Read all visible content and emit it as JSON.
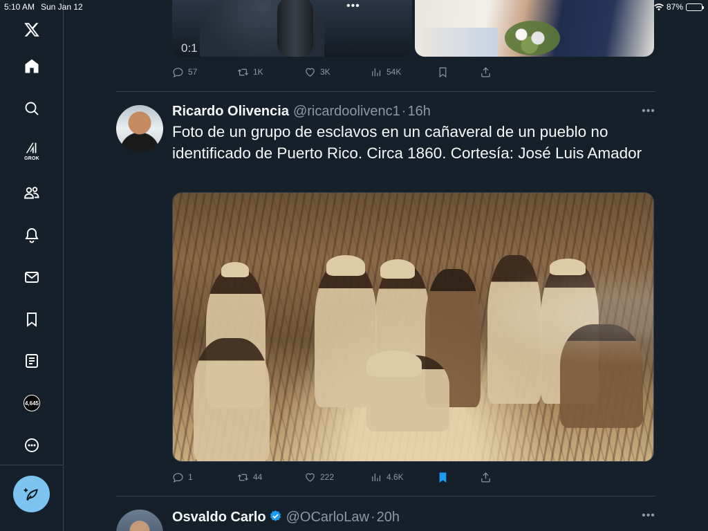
{
  "status_bar": {
    "time": "5:10 AM",
    "date": "Sun Jan 12",
    "battery": "87%",
    "battery_level": 0.87
  },
  "sidebar": {
    "items": [
      {
        "name": "x-logo-icon"
      },
      {
        "name": "home-icon"
      },
      {
        "name": "search-icon"
      },
      {
        "name": "grok-icon",
        "label": "GROK"
      },
      {
        "name": "communities-icon"
      },
      {
        "name": "notifications-icon"
      },
      {
        "name": "messages-icon"
      },
      {
        "name": "bookmarks-icon"
      },
      {
        "name": "lists-icon"
      },
      {
        "name": "profile-icon",
        "label": "4,645"
      },
      {
        "name": "more-icon"
      }
    ],
    "compose_icon": "feather-plus-icon"
  },
  "previous_tweet": {
    "video_time": "0:1",
    "stats": {
      "replies": "57",
      "reposts": "1K",
      "likes": "3K",
      "views": "54K"
    }
  },
  "tweet": {
    "name": "Ricardo Olivencia",
    "handle": "@ricardoolivenc1",
    "separator": "·",
    "time": "16h",
    "text": "Foto de un grupo de esclavos en un cañaveral de un pueblo no identificado de Puerto Rico. Circa 1860. Cortesía: José Luis Amador",
    "stats": {
      "replies": "1",
      "reposts": "44",
      "likes": "222",
      "views": "4.6K"
    },
    "bookmarked": true
  },
  "next_tweet": {
    "name": "Osvaldo Carlo",
    "handle": "@OCarloLaw",
    "separator": "·",
    "time": "20h",
    "verified": true
  },
  "colors": {
    "background": "#15202b",
    "divider": "#38444d",
    "secondary_text": "#8b98a5",
    "accent": "#1d9bf0",
    "compose_button": "#7cc3f0"
  }
}
